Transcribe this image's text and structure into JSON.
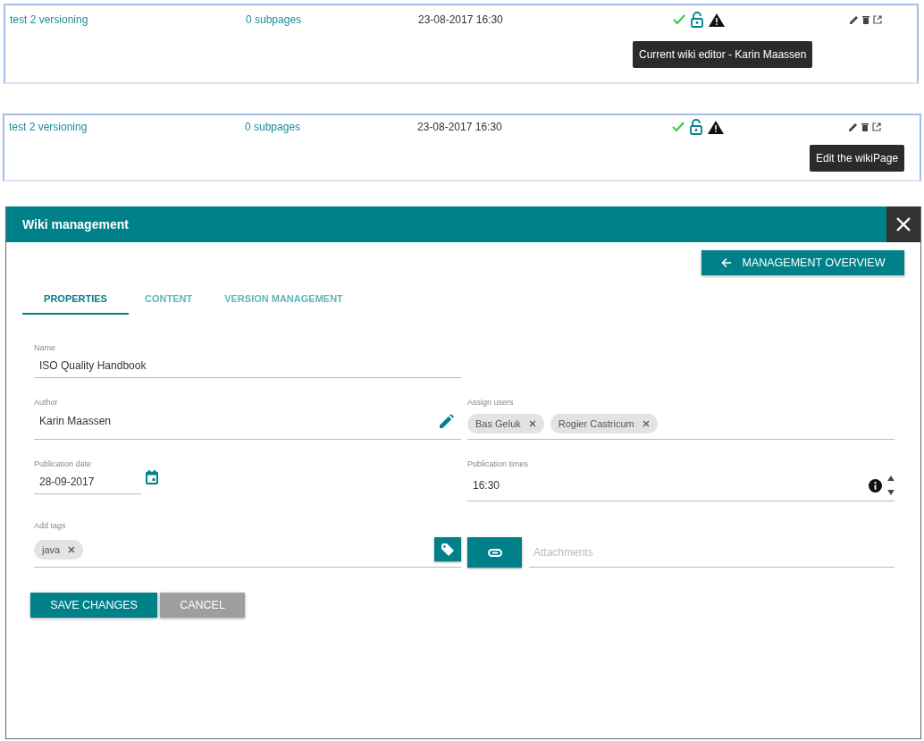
{
  "wiki_rows": [
    {
      "title": "test 2 versioning",
      "subpages": "0 subpages",
      "modified": "23-08-2017 16:30",
      "tooltip": {
        "text": "Current wiki editor - Karin Maassen",
        "kind": "status"
      }
    },
    {
      "title": "test 2 versioning",
      "subpages": "0 subpages",
      "modified": "23-08-2017 16:30",
      "tooltip": {
        "text": "Edit the wikiPage",
        "kind": "actions"
      }
    }
  ],
  "dialog": {
    "title": "Wiki management",
    "overview_button": "MANAGEMENT OVERVIEW",
    "tabs": [
      {
        "label": "PROPERTIES",
        "selected": true
      },
      {
        "label": "CONTENT",
        "selected": false
      },
      {
        "label": "VERSION MANAGEMENT",
        "selected": false
      }
    ],
    "name": {
      "label": "Name",
      "value": "ISO Quality Handbook"
    },
    "author": {
      "label": "Author",
      "value": "Karin Maassen"
    },
    "assign_users": {
      "label": "Assign users",
      "chips": [
        "Bas Geluk",
        "Rogier Castricum"
      ]
    },
    "publication_date": {
      "label": "Publication date",
      "value": "28-09-2017"
    },
    "publication_times": {
      "label": "Publication times",
      "value": "16:30"
    },
    "tags": {
      "label": "Add tags",
      "chips": [
        "java"
      ]
    },
    "attachments": {
      "placeholder": "Attachments"
    },
    "buttons": [
      {
        "label": "SAVE CHANGES",
        "kind": "primary"
      },
      {
        "label": "CANCEL",
        "kind": "secondary"
      }
    ]
  }
}
